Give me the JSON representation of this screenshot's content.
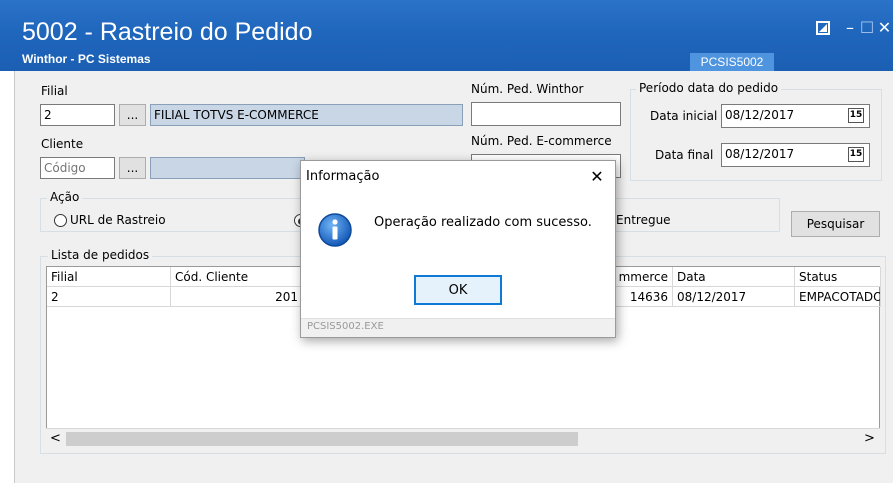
{
  "window": {
    "title": "5002 - Rastreio do Pedido",
    "subtitle": "Winthor - PC Sistemas",
    "routine_code": "PCSIS5002",
    "controls": {
      "restore_icon": "restore-icon",
      "minimize": "–",
      "maximize": "☐",
      "close": "✕"
    }
  },
  "filters": {
    "filial_label": "Filial",
    "filial_code": "2",
    "filial_lookup_button": "...",
    "filial_name": "FILIAL TOTVS E-COMMERCE",
    "cliente_label": "Cliente",
    "cliente_placeholder": "Código",
    "cliente_lookup_button": "...",
    "num_ped_winthor_label": "Núm. Ped. Winthor",
    "num_ped_winthor_value": "",
    "num_ped_ecommerce_label": "Núm. Ped. E-commerce",
    "num_ped_ecommerce_value": ""
  },
  "periodo": {
    "title": "Período data do pedido",
    "data_inicial_label": "Data inicial",
    "data_inicial_value": "08/12/2017",
    "data_final_label": "Data final",
    "data_final_value": "08/12/2017",
    "calendar_glyph": "15"
  },
  "acao": {
    "title": "Ação",
    "options": [
      {
        "label": "URL de Rastreio",
        "selected": false
      },
      {
        "label": "",
        "selected": true
      },
      {
        "label": "Entregue",
        "selected": false
      }
    ]
  },
  "search_button": "Pesquisar",
  "lista": {
    "title": "Lista de pedidos",
    "columns": [
      "Filial",
      "Cód. Cliente",
      "",
      "mmerce",
      "Data",
      "Status"
    ],
    "rows": [
      [
        "2",
        "201",
        "",
        "14636",
        "08/12/2017",
        "EMPACOTADO"
      ]
    ],
    "scroll_left": "<",
    "scroll_right": ">"
  },
  "dialog": {
    "title": "Informação",
    "close": "✕",
    "icon": "info-icon",
    "message": "Operação realizado com sucesso.",
    "ok_label": "OK",
    "footer": "PCSIS5002.EXE"
  },
  "colors": {
    "titlebar": "#1f66bd",
    "readonly_field": "#c8d6e6",
    "info_icon": "#1e6fd0"
  }
}
